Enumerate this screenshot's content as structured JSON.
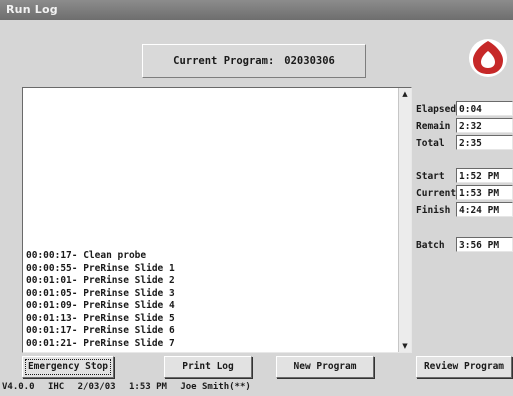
{
  "window": {
    "title": "Run Log"
  },
  "program": {
    "label": "Current Program:",
    "value": "02030306"
  },
  "log": {
    "entries": [
      "00:00:17- Clean probe",
      "00:00:55- PreRinse Slide 1",
      "00:01:01- PreRinse Slide 2",
      "00:01:05- PreRinse Slide 3",
      "00:01:09- PreRinse Slide 4",
      "00:01:13- PreRinse Slide 5",
      "00:01:17- PreRinse Slide 6",
      "00:01:21- PreRinse Slide 7"
    ],
    "scroll_up_icon": "▲",
    "scroll_down_icon": "▼"
  },
  "stats": {
    "elapsed_label": "Elapsed",
    "elapsed_value": "0:04",
    "remain_label": "Remain",
    "remain_value": "2:32",
    "total_label": "Total",
    "total_value": "2:35",
    "start_label": "Start",
    "start_value": "1:52 PM",
    "current_label": "Current",
    "current_value": "1:53 PM",
    "finish_label": "Finish",
    "finish_value": "4:24 PM",
    "batch_label": "Batch",
    "batch_value": "3:56 PM"
  },
  "buttons": {
    "emergency_stop": "Emergency Stop",
    "print_log": "Print Log",
    "new_program": "New Program",
    "review_program": "Review Program"
  },
  "statusbar": {
    "version": "V4.0.0",
    "mode": "IHC",
    "date": "2/03/03",
    "time": "1:53 PM",
    "user": "Joe Smith(**)"
  },
  "colors": {
    "titlebar": "#7a7a7a",
    "logo": "#c62828",
    "background": "#d6d6d6"
  }
}
